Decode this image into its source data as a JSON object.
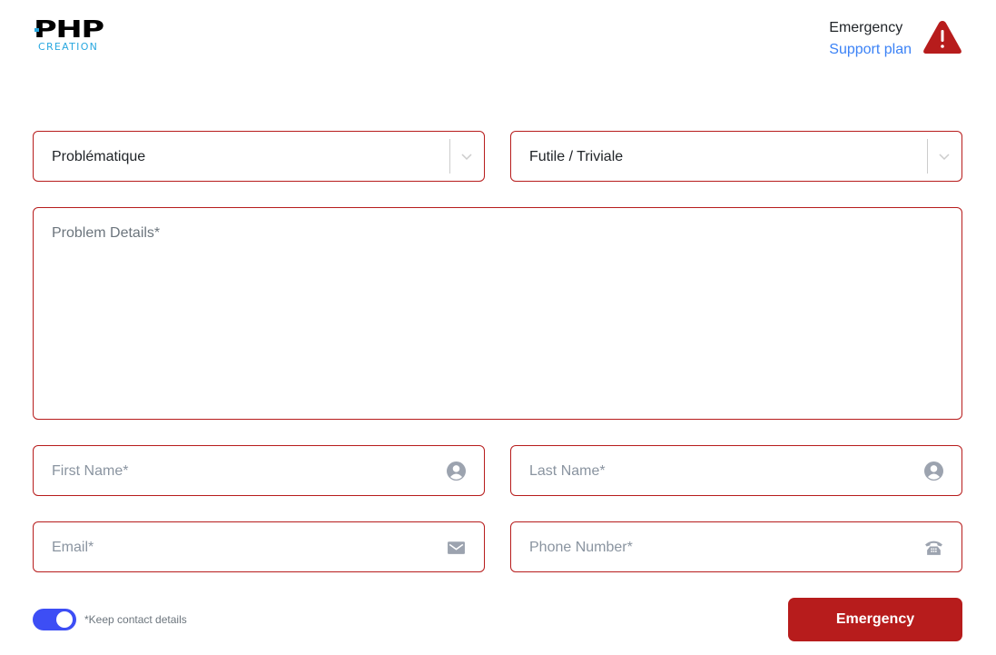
{
  "header": {
    "logo": {
      "main": "PHP",
      "sub": "CREATION"
    },
    "emergency_line1": "Emergency",
    "emergency_line2": "Support plan",
    "warning_icon": "warning-triangle-icon"
  },
  "form": {
    "category_select": {
      "value": "Problématique",
      "icon": "chevron-down-icon"
    },
    "severity_select": {
      "value": "Futile / Triviale",
      "icon": "chevron-down-icon"
    },
    "problem_details": {
      "placeholder": "Problem Details*",
      "value": ""
    },
    "first_name": {
      "placeholder": "First Name*",
      "value": "",
      "icon": "user-circle-icon"
    },
    "last_name": {
      "placeholder": "Last Name*",
      "value": "",
      "icon": "user-circle-icon"
    },
    "email": {
      "placeholder": "Email*",
      "value": "",
      "icon": "envelope-icon"
    },
    "phone": {
      "placeholder": "Phone Number*",
      "value": "",
      "icon": "telephone-icon"
    },
    "keep_contact": {
      "label": "*Keep contact details",
      "checked": true
    },
    "submit_label": "Emergency"
  },
  "colors": {
    "accent_red": "#b71c1c",
    "link_blue": "#3b82f6",
    "toggle_blue": "#3d4ef5",
    "logo_blue": "#29a8e0"
  }
}
